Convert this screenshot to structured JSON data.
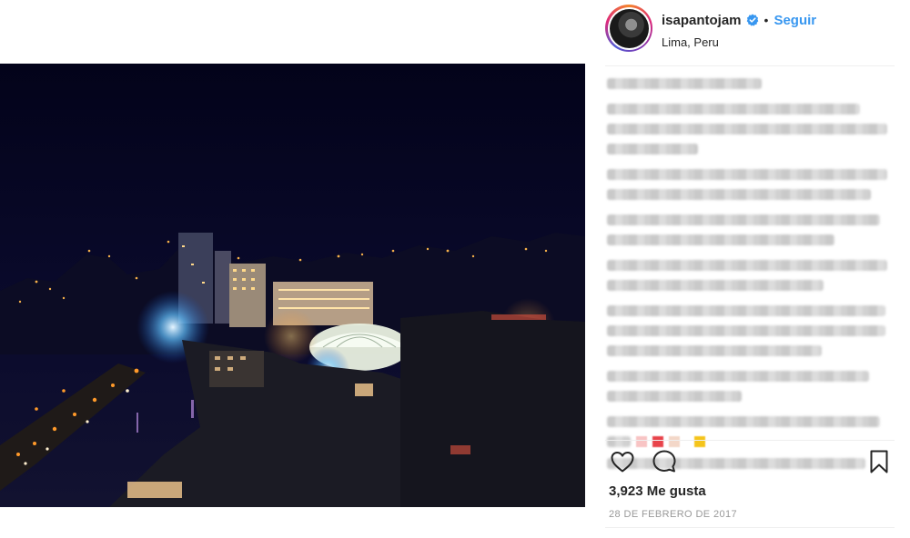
{
  "post": {
    "username": "isapantojam",
    "separator": "•",
    "follow_label": "Seguir",
    "location": "Lima, Peru",
    "likes_text": "3,923 Me gusta",
    "date": "28 DE FEBRERO DE 2017"
  },
  "icons": {
    "verified": "verified-badge-icon",
    "like": "heart-icon",
    "comment": "comment-icon",
    "save": "bookmark-icon"
  },
  "colors": {
    "link_blue": "#3897f0",
    "text": "#262626",
    "muted": "#999999",
    "photo_sky": "#05051c"
  }
}
